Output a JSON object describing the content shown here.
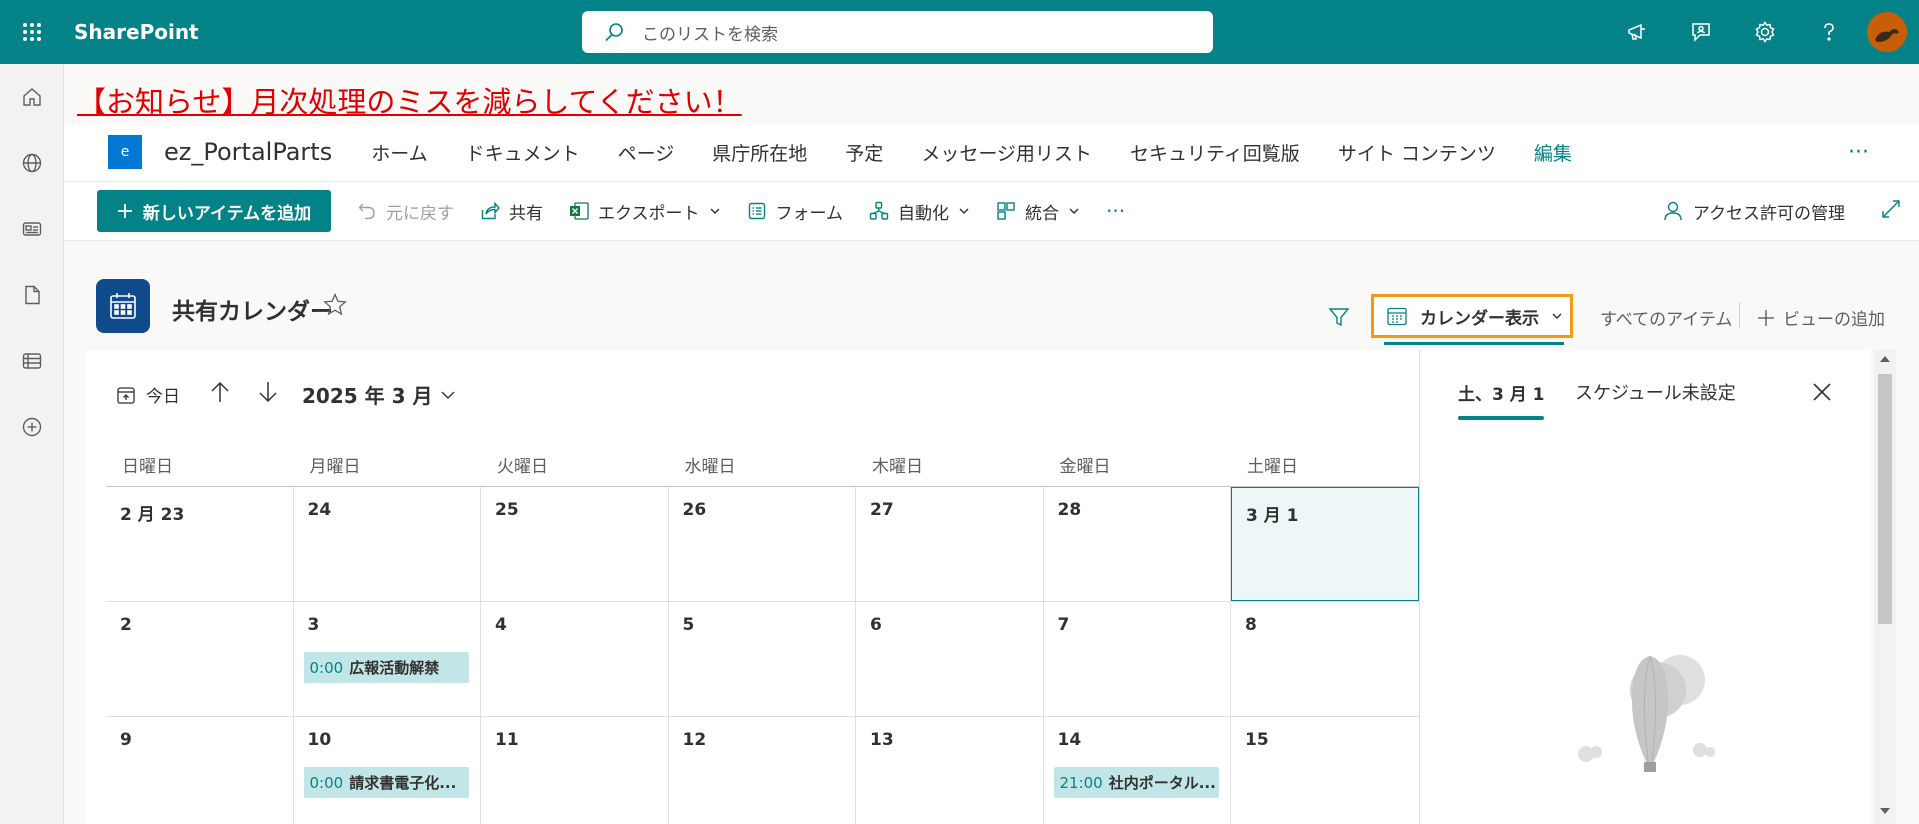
{
  "suite_bar": {
    "app_name": "SharePoint",
    "search_placeholder": "このリストを検索",
    "bg_color": "#038387"
  },
  "announcement": "【お知らせ】月次処理のミスを減らしてください！",
  "site": {
    "logo_letter": "e",
    "title": "ez_PortalParts",
    "nav": [
      "ホーム",
      "ドキュメント",
      "ページ",
      "県庁所在地",
      "予定",
      "メッセージ用リスト",
      "セキュリティ回覧版",
      "サイト コンテンツ"
    ],
    "edit": "編集",
    "more": "···"
  },
  "command_bar": {
    "new_item": "新しいアイテムを追加",
    "undo": "元に戻す",
    "share": "共有",
    "export": "エクスポート",
    "forms": "フォーム",
    "automate": "自動化",
    "integrate": "統合",
    "more": "···",
    "access": "アクセス許可の管理"
  },
  "list": {
    "title": "共有カレンダー",
    "view_name": "カレンダー表示",
    "all_items": "すべてのアイテム",
    "add_view": "ビューの追加"
  },
  "calendar": {
    "today_label": "今日",
    "month_label": "2025 年 3 月",
    "weekdays": [
      "日曜日",
      "月曜日",
      "火曜日",
      "水曜日",
      "木曜日",
      "金曜日",
      "土曜日"
    ],
    "weeks": [
      [
        {
          "d": "2 月 23"
        },
        {
          "d": "24"
        },
        {
          "d": "25"
        },
        {
          "d": "26"
        },
        {
          "d": "27"
        },
        {
          "d": "28"
        },
        {
          "d": "3 月 1",
          "selected": true
        }
      ],
      [
        {
          "d": "2"
        },
        {
          "d": "3",
          "event": {
            "time": "0:00",
            "title": "広報活動解禁"
          }
        },
        {
          "d": "4"
        },
        {
          "d": "5"
        },
        {
          "d": "6"
        },
        {
          "d": "7"
        },
        {
          "d": "8"
        }
      ],
      [
        {
          "d": "9"
        },
        {
          "d": "10",
          "event": {
            "time": "0:00",
            "title": "請求書電子化..."
          }
        },
        {
          "d": "11"
        },
        {
          "d": "12"
        },
        {
          "d": "13"
        },
        {
          "d": "14",
          "event": {
            "time": "21:00",
            "title": "社内ポータル..."
          }
        },
        {
          "d": "15"
        }
      ]
    ]
  },
  "panel": {
    "date_tab": "土、3 月 1",
    "message": "スケジュール未設定"
  }
}
